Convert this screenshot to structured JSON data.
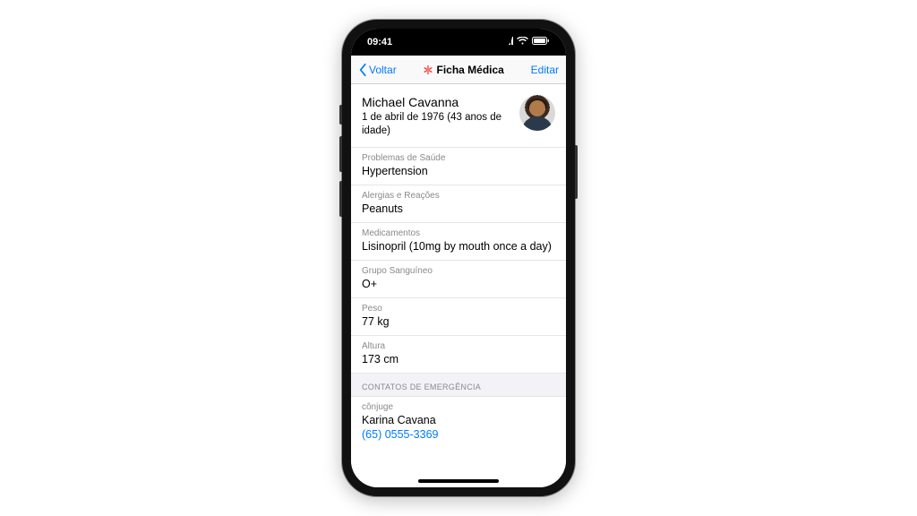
{
  "status": {
    "time": "09:41"
  },
  "nav": {
    "back": "Voltar",
    "title": "Ficha Médica",
    "edit": "Editar"
  },
  "profile": {
    "name": "Michael Cavanna",
    "dob": "1 de abril de 1976 (43 anos de idade)"
  },
  "fields": {
    "health_label": "Problemas de Saúde",
    "health_value": "Hypertension",
    "allergies_label": "Alergias e Reações",
    "allergies_value": "Peanuts",
    "meds_label": "Medicamentos",
    "meds_value": "Lisinopril (10mg by mouth once a day)",
    "blood_label": "Grupo Sanguíneo",
    "blood_value": "O+",
    "weight_label": "Peso",
    "weight_value": "77 kg",
    "height_label": "Altura",
    "height_value": "173 cm"
  },
  "emergency": {
    "section": "CONTATOS DE EMERGÊNCIA",
    "relation": "cônjuge",
    "name": "Karina Cavana",
    "phone": "(65) 0555-3369"
  }
}
